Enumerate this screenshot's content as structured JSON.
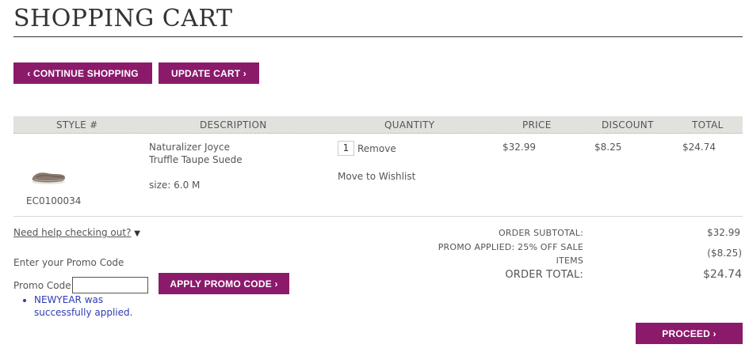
{
  "page": {
    "title": "SHOPPING CART"
  },
  "buttons": {
    "continue": "‹ CONTINUE SHOPPING",
    "update": "UPDATE CART ›",
    "apply_promo": "APPLY PROMO CODE ›",
    "proceed": "PROCEED ›"
  },
  "table": {
    "headers": {
      "style": "STYLE #",
      "description": "DESCRIPTION",
      "quantity": "QUANTITY",
      "price": "PRICE",
      "discount": "DISCOUNT",
      "total": "TOTAL"
    },
    "item": {
      "style_number": "EC0100034",
      "name_line1": "Naturalizer Joyce",
      "name_line2": "Truffle Taupe Suede",
      "size": "size: 6.0 M",
      "quantity": "1",
      "remove_label": "Remove",
      "wishlist_label": "Move to Wishlist",
      "price": "$32.99",
      "discount": "$8.25",
      "total": "$24.74",
      "image_icon": "shoe-flat-icon"
    }
  },
  "help": {
    "link_text": "Need help checking out?",
    "arrow": "▼"
  },
  "promo": {
    "prompt": "Enter your Promo Code",
    "label": "Promo Code",
    "input_value": "",
    "message": "NEWYEAR was successfully applied."
  },
  "summary": {
    "subtotal_label": "ORDER SUBTOTAL:",
    "subtotal_value": "$32.99",
    "promo_label_line1": "PROMO APPLIED: 25% OFF SALE",
    "promo_label_line2": "ITEMS",
    "promo_value": "($8.25)",
    "total_label": "ORDER TOTAL:",
    "total_value": "$24.74"
  },
  "colors": {
    "accent": "#8b1a6b",
    "header_bg": "#e1e1de",
    "success_text": "#2e3bb3"
  }
}
